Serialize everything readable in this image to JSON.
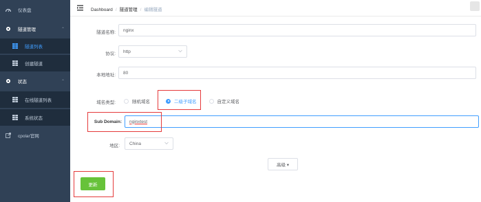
{
  "sidebar": {
    "dashboard": {
      "label": "仪表盘",
      "icon": "dashboard-icon"
    },
    "tunnel_mgmt": {
      "label": "隧道管理",
      "icon": "gear-icon"
    },
    "tunnel_list": {
      "label": "隧道列表",
      "icon": "grid-icon"
    },
    "create_tunnel": {
      "label": "创建隧道",
      "icon": "grid-icon"
    },
    "status": {
      "label": "状态",
      "icon": "gear-icon"
    },
    "online_tunnels": {
      "label": "在线隧道列表",
      "icon": "grid-icon"
    },
    "system_status": {
      "label": "系统状态",
      "icon": "grid-icon"
    },
    "cpolar_site": {
      "label": "cpolar官网",
      "icon": "external-link-icon"
    }
  },
  "header": {
    "breadcrumb": [
      "Dashboard",
      "隧道管理",
      "编辑隧道"
    ]
  },
  "form": {
    "tunnel_name": {
      "label": "隧道名称:",
      "value": "nginx"
    },
    "protocol": {
      "label": "协议:",
      "value": "http"
    },
    "local_address": {
      "label": "本地地址:",
      "value": "80"
    },
    "domain_type": {
      "label": "域名类型:",
      "options": [
        "随机域名",
        "二级子域名",
        "自定义域名"
      ],
      "selected": "二级子域名"
    },
    "sub_domain": {
      "label": "Sub Domain:",
      "value": "nginxtest"
    },
    "region": {
      "label": "地区:",
      "value": "China"
    },
    "advanced_label": "高级 ▾",
    "update_label": "更新"
  },
  "colors": {
    "sidebar_bg": "#304156",
    "submenu_bg": "#1f2d3d",
    "accent": "#409eff",
    "highlight": "#e5393a",
    "update_button": "#67c23a"
  }
}
